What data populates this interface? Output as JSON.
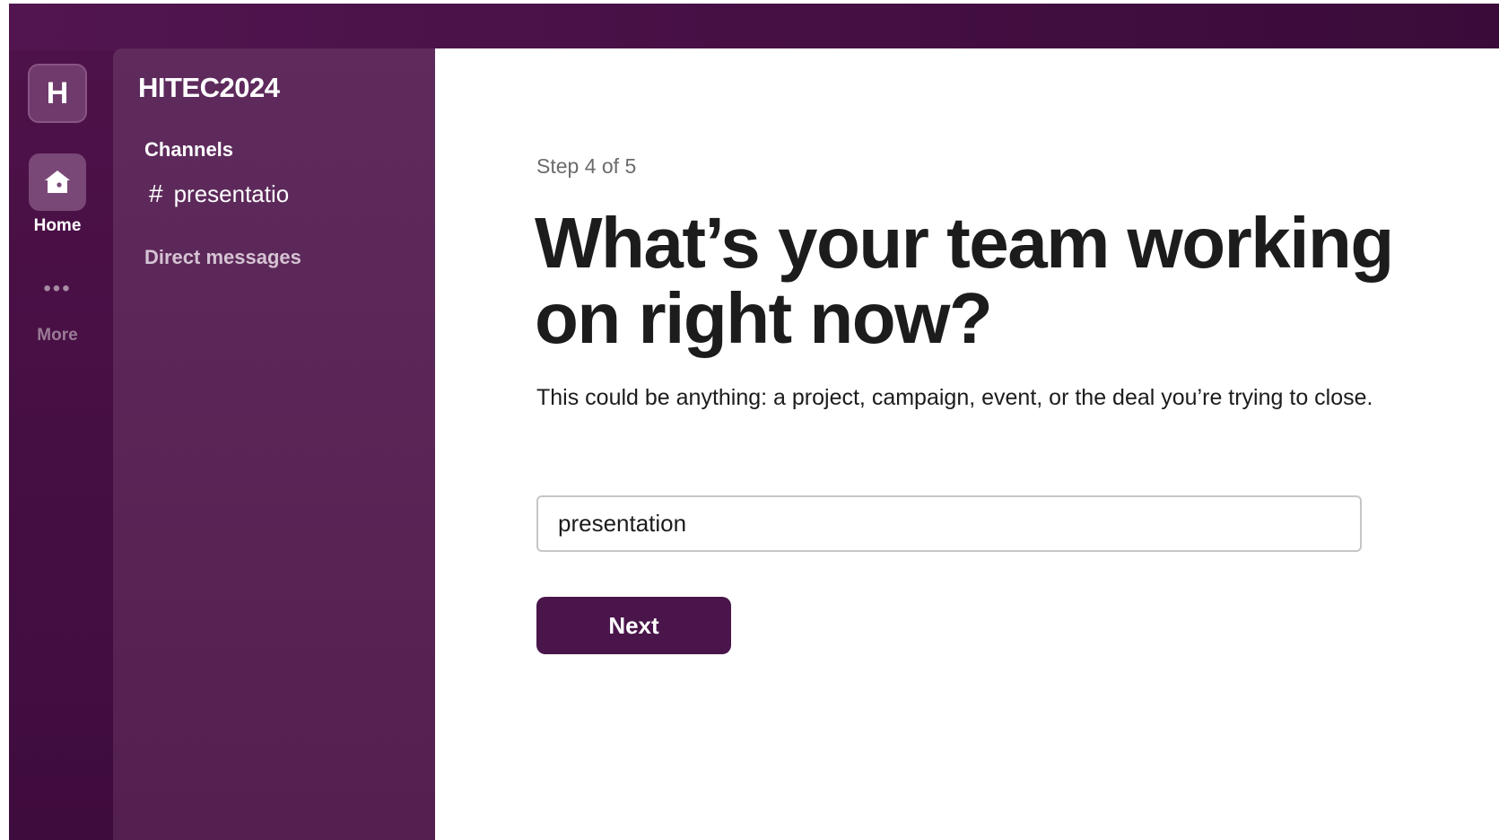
{
  "workspace": {
    "initial": "H",
    "name": "HITEC2024"
  },
  "rail": {
    "home_label": "Home",
    "more_dots": "•••",
    "more_label": "More"
  },
  "sidebar": {
    "channels_title": "Channels",
    "channels": [
      {
        "hash": "#",
        "name": "presentatio"
      }
    ],
    "direct_messages_title": "Direct messages"
  },
  "main": {
    "step": "Step 4 of 5",
    "headline": "What’s your team working on right now?",
    "description": "This could be anything: a project, campaign, event, or the deal you’re trying to close.",
    "input_value": "presentation",
    "next_label": "Next"
  },
  "colors": {
    "aubergine": "#4a154b",
    "sidebar": "#5f2b5d",
    "rail": "#4d1249"
  },
  "icons": {
    "home": "home-icon",
    "more": "more-dots-icon",
    "channel": "hash-icon"
  }
}
